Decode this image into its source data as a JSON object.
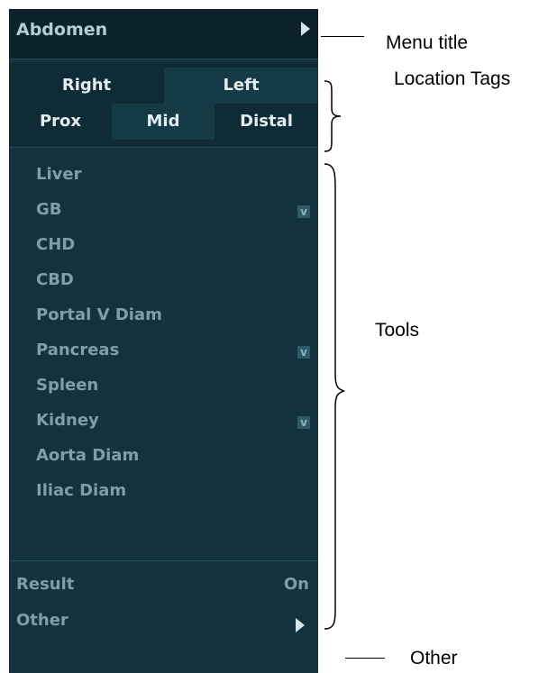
{
  "menu": {
    "title": "Abdomen",
    "location_tags": {
      "row1": [
        "Right",
        "Left"
      ],
      "row2": [
        "Prox",
        "Mid",
        "Distal"
      ]
    },
    "tools": [
      {
        "label": "Liver",
        "has_submenu": false
      },
      {
        "label": "GB",
        "has_submenu": true
      },
      {
        "label": "CHD",
        "has_submenu": false
      },
      {
        "label": "CBD",
        "has_submenu": false
      },
      {
        "label": "Portal V Diam",
        "has_submenu": false
      },
      {
        "label": "Pancreas",
        "has_submenu": true
      },
      {
        "label": "Spleen",
        "has_submenu": false
      },
      {
        "label": "Kidney",
        "has_submenu": true
      },
      {
        "label": "Aorta Diam",
        "has_submenu": false
      },
      {
        "label": "Iliac Diam",
        "has_submenu": false
      }
    ],
    "result_label": "Result",
    "result_value": "On",
    "other_label": "Other"
  },
  "annotations": {
    "menu_title": "Menu title",
    "location_tags": "Location Tags",
    "tools": "Tools",
    "other": "Other"
  },
  "colors": {
    "panel_bg": "#12323d",
    "title_bg": "#0b222b",
    "text_bright": "#e3ecef",
    "text_dim": "#7f9fa8"
  }
}
